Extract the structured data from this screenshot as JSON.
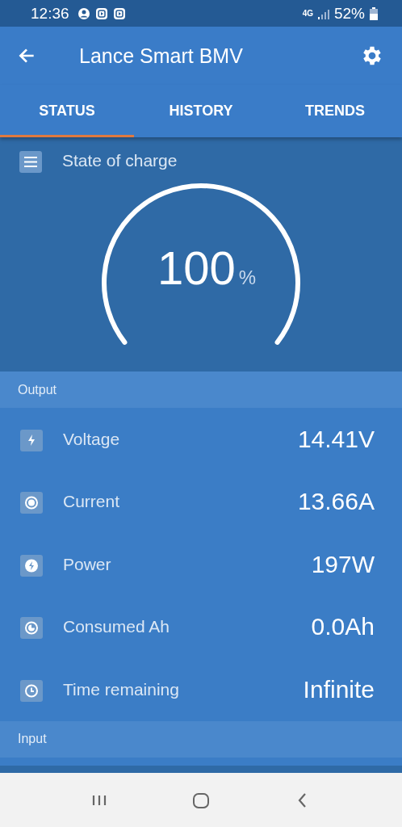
{
  "status_bar": {
    "time": "12:36",
    "network": "4G",
    "battery": "52%"
  },
  "app_bar": {
    "title": "Lance Smart BMV"
  },
  "tabs": [
    {
      "label": "STATUS",
      "selected": true
    },
    {
      "label": "HISTORY",
      "selected": false
    },
    {
      "label": "TRENDS",
      "selected": false
    }
  ],
  "state_of_charge": {
    "label": "State of charge",
    "value": "100",
    "unit": "%"
  },
  "sections": [
    {
      "title": "Output",
      "rows": [
        {
          "label": "Voltage",
          "value": "14.41V"
        },
        {
          "label": "Current",
          "value": "13.66A"
        },
        {
          "label": "Power",
          "value": "197W"
        },
        {
          "label": "Consumed Ah",
          "value": "0.0Ah"
        },
        {
          "label": "Time remaining",
          "value": "Infinite"
        }
      ]
    },
    {
      "title": "Input"
    }
  ]
}
